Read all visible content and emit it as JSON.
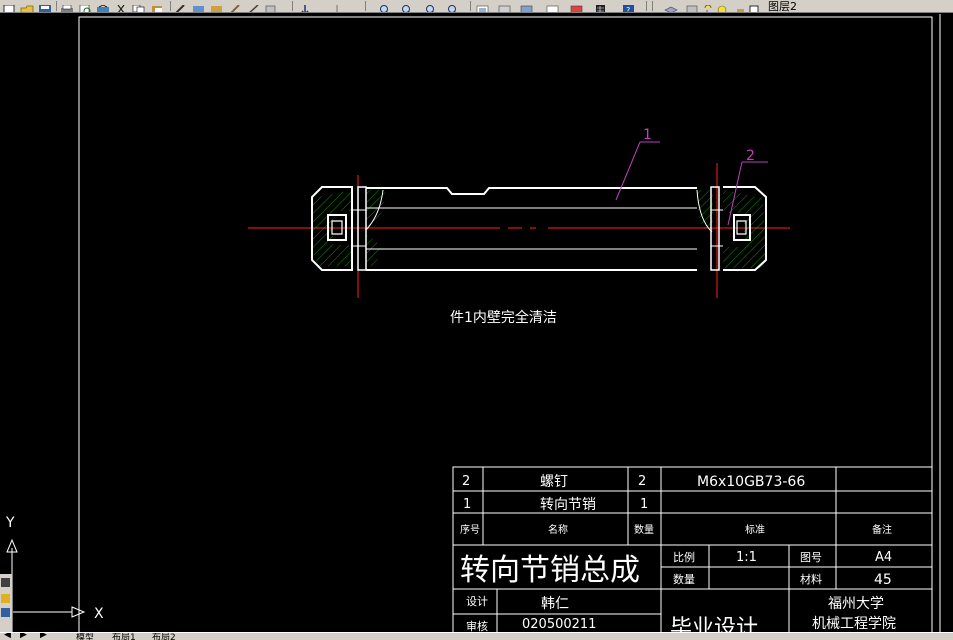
{
  "toolbar": {
    "layer_name": "图层2",
    "icons": [
      "new-icon",
      "open-icon",
      "save-icon",
      "print-icon",
      "preview-icon",
      "publish-icon",
      "cut-icon",
      "copy-icon",
      "paste-icon",
      "match-properties-icon",
      "undo-icon",
      "redo-icon",
      "pan-icon",
      "zoom-realtime-icon",
      "zoom-window-icon",
      "zoom-previous-icon",
      "properties-icon",
      "design-center-icon",
      "tool-palettes-icon",
      "calculator-icon",
      "help-icon",
      "layer-manager-icon",
      "layer-on-icon",
      "layer-freeze-icon",
      "layer-color-icon"
    ]
  },
  "drawing": {
    "note": "件1内壁完全清洁",
    "leaders": [
      {
        "label": "1"
      },
      {
        "label": "2"
      }
    ]
  },
  "title_block": {
    "parts_list": [
      {
        "no": "2",
        "name": "螺钉",
        "qty": "2",
        "standard": "M6x10GB73-66",
        "remark": ""
      },
      {
        "no": "1",
        "name": "转向节销",
        "qty": "1",
        "standard": "",
        "remark": ""
      }
    ],
    "headers": {
      "no": "序号",
      "name": "名称",
      "qty": "数量",
      "standard": "标准",
      "remark": "备注"
    },
    "assembly_title": "转向节销总成",
    "scale_label": "比例",
    "scale_value": "1:1",
    "sheet_label": "图号",
    "sheet_value": "A4",
    "count_label": "数量",
    "material_label": "材料",
    "material_value": "45",
    "designer_label": "设计",
    "checker_label": "审核",
    "designer_name": "韩仁",
    "student_id": "020500211",
    "project": "毕业设计",
    "school_line1": "福州大学",
    "school_line2": "机械工程学院"
  },
  "ucs": {
    "x_label": "X",
    "y_label": "Y"
  },
  "layout_tabs": [
    "模型",
    "布局1",
    "布局2"
  ],
  "colors": {
    "background": "#000000",
    "geometry": "#ffffff",
    "centerline": "#ff0000",
    "hatch": "#00c000",
    "leader": "#c040c0",
    "dimension": "#ff00ff"
  }
}
